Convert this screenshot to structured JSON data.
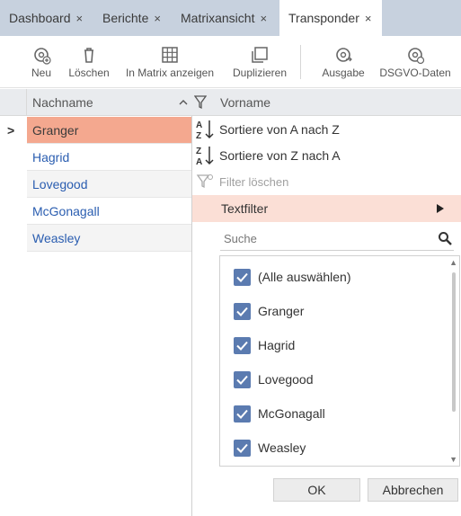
{
  "tabs": [
    {
      "label": "Dashboard",
      "active": false
    },
    {
      "label": "Berichte",
      "active": false
    },
    {
      "label": "Matrixansicht",
      "active": false
    },
    {
      "label": "Transponder",
      "active": true
    }
  ],
  "close_glyph": "×",
  "toolbar": {
    "new": {
      "label": "Neu",
      "icon": "new-icon"
    },
    "delete": {
      "label": "Löschen",
      "icon": "trash-icon"
    },
    "matrix": {
      "label": "In Matrix anzeigen",
      "icon": "matrix-icon"
    },
    "duplicate": {
      "label": "Duplizieren",
      "icon": "duplicate-icon"
    },
    "output": {
      "label": "Ausgabe",
      "icon": "output-icon"
    },
    "gdpr": {
      "label": "DSGVO-Daten",
      "icon": "gdpr-icon"
    }
  },
  "grid": {
    "columns": {
      "lastname": "Nachname",
      "firstname": "Vorname"
    },
    "rows": [
      {
        "lastname": "Granger",
        "selected": true
      },
      {
        "lastname": "Hagrid",
        "selected": false
      },
      {
        "lastname": "Lovegood",
        "selected": false
      },
      {
        "lastname": "McGonagall",
        "selected": false
      },
      {
        "lastname": "Weasley",
        "selected": false
      }
    ]
  },
  "filter_menu": {
    "sort_asc": "Sortiere von A nach Z",
    "sort_desc": "Sortiere von Z nach A",
    "clear_filter": "Filter löschen",
    "text_filter": "Textfilter",
    "search_placeholder": "Suche",
    "items": [
      {
        "label": "(Alle auswählen)",
        "checked": true
      },
      {
        "label": "Granger",
        "checked": true
      },
      {
        "label": "Hagrid",
        "checked": true
      },
      {
        "label": "Lovegood",
        "checked": true
      },
      {
        "label": "McGonagall",
        "checked": true
      },
      {
        "label": "Weasley",
        "checked": true
      }
    ],
    "ok": "OK",
    "cancel": "Abbrechen"
  },
  "colors": {
    "tabbar": "#c7d1de",
    "selected_row": "#f4a88f",
    "highlight_item": "#fbdfd6",
    "checkbox": "#5b7bb0",
    "link_text": "#2a5db0"
  }
}
